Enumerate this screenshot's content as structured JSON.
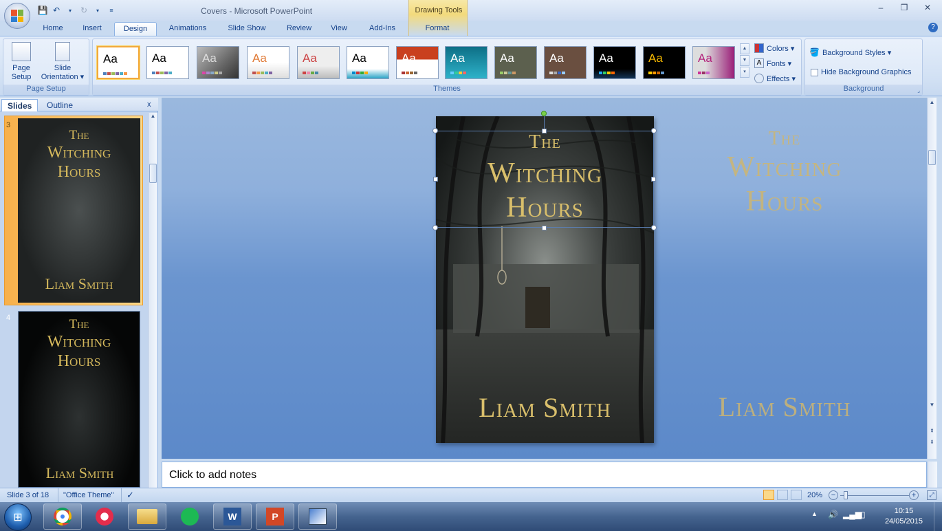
{
  "window": {
    "title": "Covers - Microsoft PowerPoint",
    "context_tab_group": "Drawing Tools"
  },
  "window_controls": {
    "minimize": "–",
    "restore": "❐",
    "close": "✕"
  },
  "tabs": [
    {
      "label": "Home"
    },
    {
      "label": "Insert"
    },
    {
      "label": "Design",
      "active": true
    },
    {
      "label": "Animations"
    },
    {
      "label": "Slide Show"
    },
    {
      "label": "Review"
    },
    {
      "label": "View"
    },
    {
      "label": "Add-Ins"
    },
    {
      "label": "Format"
    }
  ],
  "ribbon": {
    "page_setup": {
      "label": "Page Setup",
      "page_setup_btn": "Page Setup",
      "orientation_btn": "Slide Orientation ▾"
    },
    "themes": {
      "label": "Themes",
      "sample": "Aa"
    },
    "theme_options": {
      "colors": "Colors ▾",
      "fonts": "Fonts ▾",
      "effects": "Effects ▾"
    },
    "background": {
      "label": "Background",
      "styles": "Background Styles ▾",
      "hide": "Hide Background Graphics"
    }
  },
  "slide_panel": {
    "tabs": {
      "slides": "Slides",
      "outline": "Outline",
      "close": "x"
    },
    "thumbs": [
      {
        "number": "3",
        "title_line1": "The",
        "title_line2": "Witching",
        "title_line3": "Hours",
        "author": "Liam Smith"
      },
      {
        "number": "4",
        "title_line1": "The",
        "title_line2": "Witching",
        "title_line3": "Hours",
        "author": "Liam Smith"
      }
    ]
  },
  "slide": {
    "title_line1": "The",
    "title_line2": "Witching",
    "title_line3": "Hours",
    "author": "Liam Smith",
    "ghost_title_line1": "The",
    "ghost_title_line2": "Witching",
    "ghost_title_line3": "Hours",
    "ghost_author": "Liam Smith"
  },
  "notes": {
    "placeholder": "Click to add notes"
  },
  "status": {
    "slide_info": "Slide 3 of 18",
    "theme": "\"Office Theme\"",
    "zoom": "20%"
  },
  "taskbar": {
    "time": "10:15",
    "date": "24/05/2015"
  },
  "colors": {
    "gold": "#d9bf6b",
    "ribbon_blue": "#15428b",
    "accent_orange": "#f2a83a"
  }
}
